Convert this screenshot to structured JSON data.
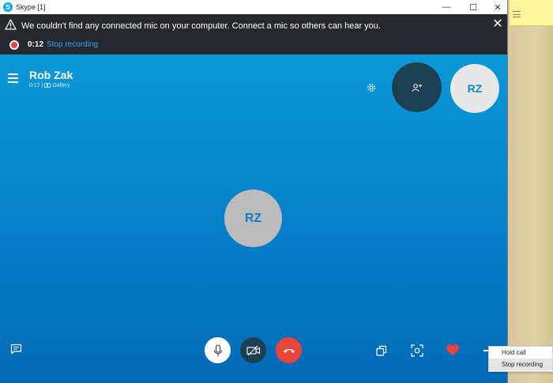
{
  "window": {
    "title": "Skype [1]",
    "app_icon_letter": "S",
    "controls": {
      "minimize": "—",
      "maximize": "☐",
      "close": "✕"
    }
  },
  "banner": {
    "warning_text": "We couldn't find any connected mic on your computer. Connect a mic so others can hear you.",
    "close_glyph": "✕",
    "recording_time": "0:12",
    "stop_recording_label": "Stop recording"
  },
  "call": {
    "caller_name": "Rob Zak",
    "duration": "0:17",
    "separator": "|",
    "view_mode": "Gallery",
    "self_initials": "RZ",
    "participant_initials": "RZ"
  },
  "context_menu": {
    "items": [
      {
        "label": "Hold call"
      },
      {
        "label": "Stop recording"
      }
    ]
  },
  "colors": {
    "banner_bg": "#25292e",
    "call_bg_top": "#0a98d6",
    "call_bg_bottom": "#0369b6",
    "hangup": "#e8453c",
    "dark_button": "#1d3f52",
    "link": "#2aa4ee",
    "heart": "#e8453c"
  },
  "icons": {
    "warning": "warning-triangle-icon",
    "menu": "hamburger-menu-icon",
    "settings": "gear-icon",
    "add_participant": "add-person-icon",
    "chat": "chat-icon",
    "mic": "microphone-icon",
    "video_off": "video-off-icon",
    "hang_up": "hang-up-icon",
    "share_screen": "share-screen-icon",
    "snapshot": "snapshot-icon",
    "reaction": "heart-icon",
    "more": "more-options-icon"
  }
}
